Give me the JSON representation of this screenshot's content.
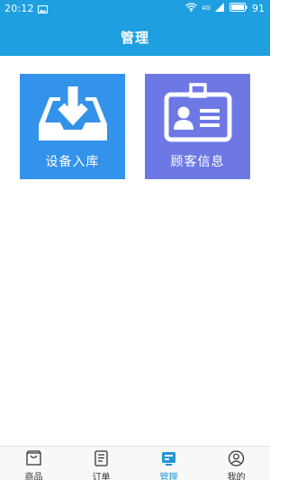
{
  "status_bar": {
    "time": "20:12",
    "network": "4G",
    "battery": "91",
    "icons": [
      "image-icon",
      "wifi-icon",
      "signal-icon",
      "battery-icon"
    ]
  },
  "header": {
    "title": "管理"
  },
  "tiles": [
    {
      "label": "设备入库",
      "icon": "inbox-download-icon",
      "color": "#3392ea"
    },
    {
      "label": "顾客信息",
      "icon": "id-card-icon",
      "color": "#6d78e5"
    }
  ],
  "tabbar": {
    "items": [
      {
        "label": "商品",
        "icon": "bag-icon"
      },
      {
        "label": "订单",
        "icon": "order-list-icon"
      },
      {
        "label": "管理",
        "icon": "manage-icon",
        "active": true
      },
      {
        "label": "我的",
        "icon": "user-icon"
      }
    ]
  },
  "colors": {
    "header": "#1e9fe0",
    "active_tab": "#2196d8"
  }
}
